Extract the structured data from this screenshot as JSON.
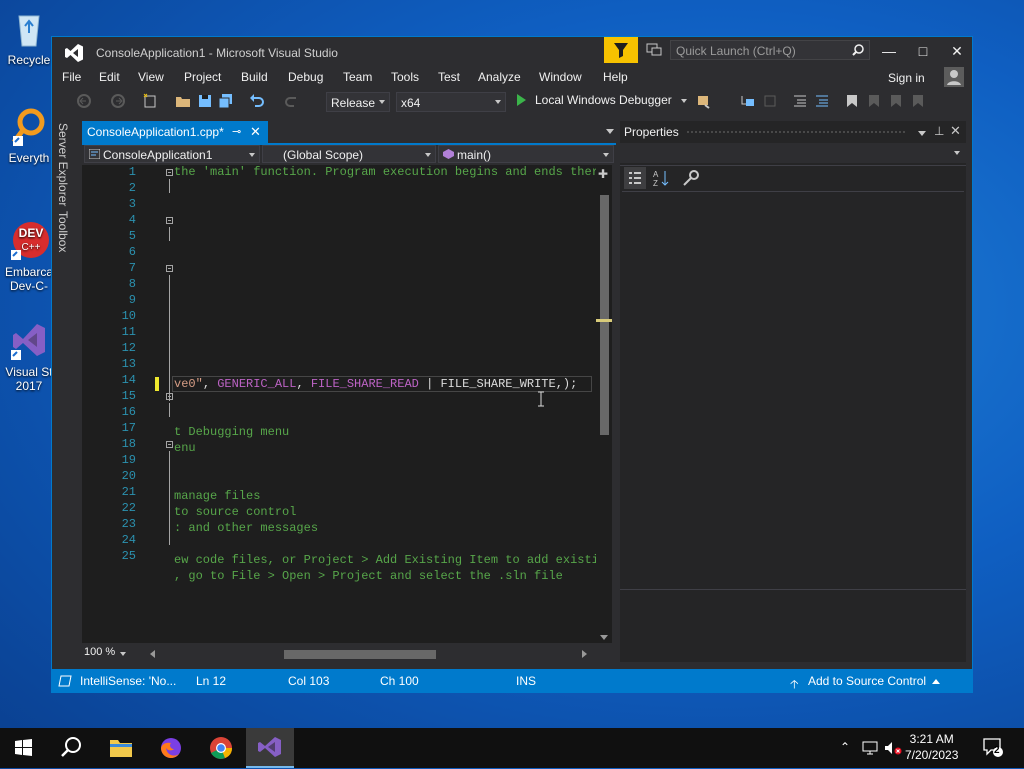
{
  "desktop": {
    "icons": [
      {
        "label": "Recycle"
      },
      {
        "label": "Everyth"
      },
      {
        "label": "Embarca\nDev-C-"
      },
      {
        "label": "Visual St\n2017"
      }
    ]
  },
  "window": {
    "title": "ConsoleApplication1 - Microsoft Visual Studio",
    "quick_launch_placeholder": "Quick Launch (Ctrl+Q)",
    "sign_in": "Sign in"
  },
  "menu": [
    "File",
    "Edit",
    "View",
    "Project",
    "Build",
    "Debug",
    "Team",
    "Tools",
    "Test",
    "Analyze",
    "Window",
    "Help"
  ],
  "toolbar": {
    "configuration": "Release",
    "platform": "x64",
    "debugger": "Local Windows Debugger"
  },
  "side_tabs": [
    "Server Explorer",
    "Toolbox"
  ],
  "editor": {
    "tab_label": "ConsoleApplication1.cpp*",
    "tab_pin": "⊸",
    "tab_close": "✕",
    "nav_project": "ConsoleApplication1",
    "nav_scope": "(Global Scope)",
    "nav_member": "main()",
    "zoom": "100 %",
    "line_numbers": [
      "1",
      "2",
      "3",
      "4",
      "5",
      "6",
      "7",
      "8",
      "9",
      "10",
      "11",
      "12",
      "13",
      "14",
      "15",
      "16",
      "17",
      "18",
      "19",
      "20",
      "21",
      "22",
      "23",
      "24",
      "25"
    ],
    "lines": {
      "l1": "the 'main' function. Program execution begins and ends there.",
      "l12_a": "ve0\"",
      "l12_b": ", ",
      "l12_c": "GENERIC_ALL",
      "l12_d": ", ",
      "l12_e": "FILE_SHARE_READ",
      "l12_f": " | ",
      "l12_g": "FILE_SHARE_WRITE",
      "l12_h": ",);",
      "l15": "t Debugging menu",
      "l16": "enu",
      "l19": "manage files",
      "l20": "to source control",
      "l21": ": and other messages",
      "l23": "ew code files, or Project > Add Existing Item to add existing",
      "l24": ", go to File > Open > Project and select the .sln file"
    }
  },
  "status": {
    "intellisense": "IntelliSense: 'No...",
    "ln": "Ln 12",
    "col": "Col 103",
    "ch": "Ch 100",
    "ins": "INS",
    "source_control": "Add to Source Control"
  },
  "properties": {
    "title": "Properties"
  },
  "taskbar": {
    "time": "3:21 AM",
    "date": "7/20/2023",
    "notifications": "2"
  },
  "colors": {
    "accent": "#007acc",
    "editor_bg": "#1e1e1e",
    "comment": "#57a64a",
    "string": "#d69d85",
    "macro": "#bd63c5",
    "line_number": "#2b91af"
  }
}
